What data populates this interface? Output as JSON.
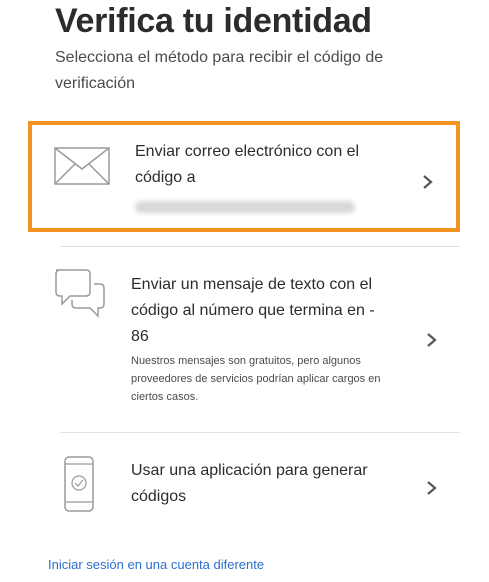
{
  "header": {
    "title": "Verifica tu identidad",
    "subtitle": "Selecciona el método para recibir el código de verificación"
  },
  "options": [
    {
      "icon": "envelope-icon",
      "label": "Enviar correo electrónico con el código a",
      "selected": true
    },
    {
      "icon": "chat-bubbles-icon",
      "label": "Enviar un mensaje de texto con el código al número que termina en - 86",
      "note": "Nuestros mensajes son gratuitos, pero algunos proveedores de servicios podrían aplicar cargos en ciertos casos.",
      "selected": false
    },
    {
      "icon": "phone-check-icon",
      "label": "Usar una aplicación para generar códigos",
      "selected": false
    }
  ],
  "footer": {
    "link": "Iniciar sesión en una cuenta diferente"
  },
  "colors": {
    "selected_border": "#f2941f",
    "link": "#2b6fd1",
    "icon_stroke": "#9a9a9a"
  }
}
